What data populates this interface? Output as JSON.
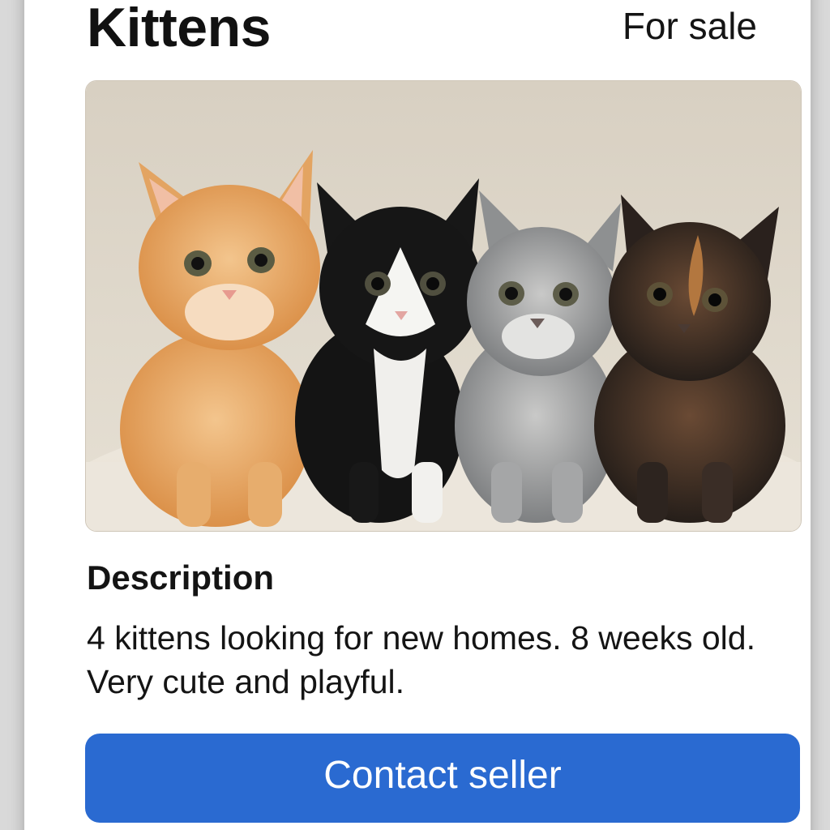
{
  "listing": {
    "title": "Kittens",
    "status": "For sale",
    "photo_subject": "four kittens",
    "description_heading": "Description",
    "description_text": "4 kittens looking for new homes. 8 weeks old. Very cute and playful.",
    "contact_button_label": "Contact seller"
  },
  "colors": {
    "accent": "#2a6ad1",
    "card_background": "#ffffff",
    "page_background": "#d9d9d9"
  }
}
